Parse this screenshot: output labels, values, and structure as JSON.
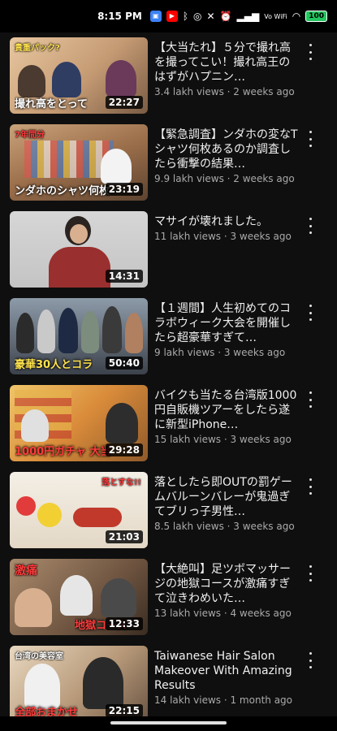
{
  "status_bar": {
    "time": "8:15 PM",
    "network": "Vo WiFi",
    "battery": "100"
  },
  "videos": [
    {
      "title": "【大当たれ】５分で撮れ高を撮ってこい！撮れ高王のはずがハプニン…",
      "views": "3.4 lakh views",
      "age": "2 weeks ago",
      "duration": "22:27",
      "caption": "撮れ高をとって",
      "top_caption": "貴重パック?",
      "thumb_color": "#d9b08c"
    },
    {
      "title": "【緊急調査】ンダホの変なTシャツ何枚あるのか調査したら衝撃の結果…",
      "views": "9.9 lakh views",
      "age": "2 weeks ago",
      "duration": "23:19",
      "caption": "ンダホのシャツ何枚",
      "top_caption": "7年間分",
      "thumb_color": "#b8835a"
    },
    {
      "title": "マサイが壊れました。",
      "views": "11 lakh views",
      "age": "3 weeks ago",
      "duration": "14:31",
      "caption": "",
      "top_caption": "",
      "thumb_color": "#cfcfcf"
    },
    {
      "title": "【１週間】人生初めてのコラボウィーク大会を開催したら超豪華すぎて…",
      "views": "9 lakh views",
      "age": "3 weeks ago",
      "duration": "50:40",
      "caption": "豪華30人とコラ",
      "top_caption": "",
      "thumb_color": "#6e7b8c"
    },
    {
      "title": "バイクも当たる台湾版1000円自販機ツアーをしたら遂に新型iPhone…",
      "views": "15 lakh views",
      "age": "3 weeks ago",
      "duration": "29:28",
      "caption": "1000円ガチャ 大当",
      "top_caption": "",
      "thumb_color": "#d7a24a"
    },
    {
      "title": "落としたら即OUTの罰ゲームバルーンバレーが鬼過ぎてブリっ子男性…",
      "views": "8.5 lakh views",
      "age": "3 weeks ago",
      "duration": "21:03",
      "caption": "",
      "top_caption": "落とすな!!",
      "thumb_color": "#e9e1d3"
    },
    {
      "title": "【大絶叫】足ツボマッサージの地獄コースが激痛すぎて泣きわめいた…",
      "views": "13 lakh views",
      "age": "4 weeks ago",
      "duration": "12:33",
      "caption": "地獄コース",
      "top_caption": "激痛",
      "thumb_color": "#8a6a52"
    },
    {
      "title": "Taiwanese Hair Salon Makeover With Amazing Results",
      "views": "14 lakh views",
      "age": "1 month ago",
      "duration": "22:15",
      "caption": "全部おまかせ",
      "top_caption": "台湾の美容室",
      "thumb_color": "#cbb79e"
    }
  ]
}
